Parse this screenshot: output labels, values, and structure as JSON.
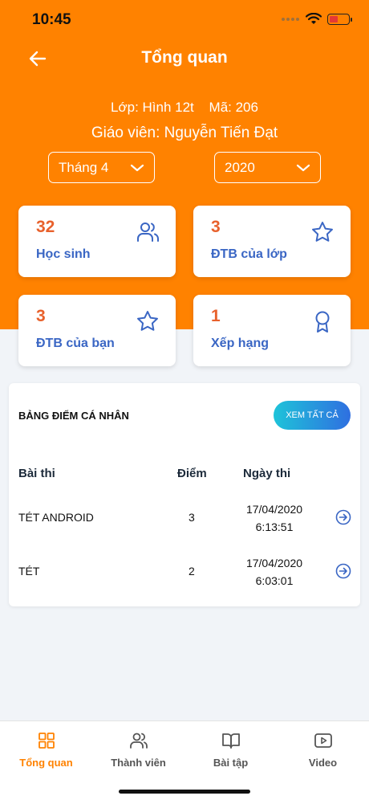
{
  "status": {
    "time": "10:45"
  },
  "header": {
    "title": "Tổng quan"
  },
  "class_info": {
    "class_label": "Lớp: Hình 12t",
    "code_label": "Mã: 206",
    "teacher_label": "Giáo viên: Nguyễn Tiến Đạt"
  },
  "filters": {
    "month": "Tháng 4",
    "year": "2020"
  },
  "stats": [
    {
      "value": "32",
      "label": "Học sinh",
      "icon": "users-icon"
    },
    {
      "value": "3",
      "label": "ĐTB của lớp",
      "icon": "star-icon"
    },
    {
      "value": "3",
      "label": "ĐTB của bạn",
      "icon": "star-icon"
    },
    {
      "value": "1",
      "label": "Xếp hạng",
      "icon": "award-icon"
    }
  ],
  "scoreboard": {
    "title": "BẢNG ĐIỂM CÁ NHÂN",
    "see_all": "XEM TẤT CẢ",
    "columns": {
      "exam": "Bài thi",
      "score": "Điểm",
      "date": "Ngày thi"
    },
    "rows": [
      {
        "exam": "TÉT ANDROID",
        "score": "3",
        "date": "17/04/2020",
        "time": "6:13:51"
      },
      {
        "exam": "TÉT",
        "score": "2",
        "date": "17/04/2020",
        "time": "6:03:01"
      }
    ]
  },
  "tabs": [
    {
      "label": "Tổng quan",
      "icon": "grid-icon",
      "active": true
    },
    {
      "label": "Thành viên",
      "icon": "users-icon",
      "active": false
    },
    {
      "label": "Bài tập",
      "icon": "book-icon",
      "active": false
    },
    {
      "label": "Video",
      "icon": "video-icon",
      "active": false
    }
  ],
  "colors": {
    "primary": "#ff8200",
    "stat_value": "#e8612c",
    "stat_label": "#3a66c4",
    "tab_active": "#ff8200"
  }
}
